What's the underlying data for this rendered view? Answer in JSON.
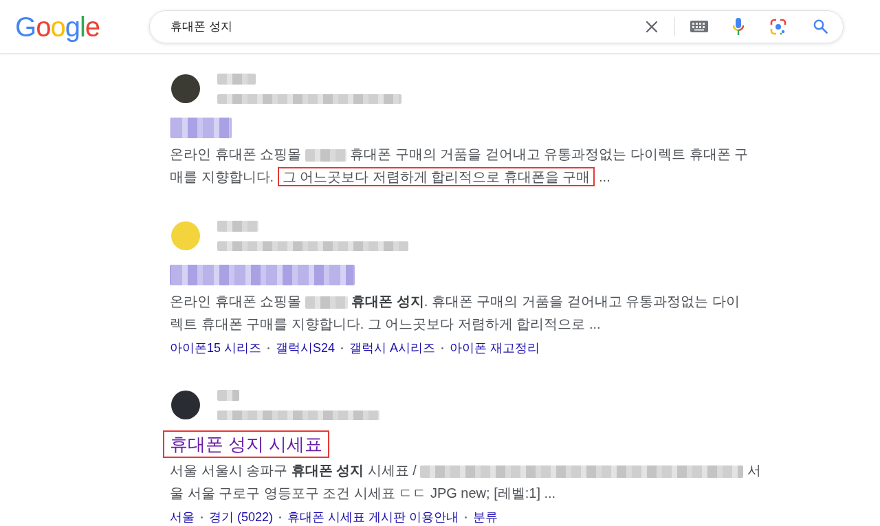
{
  "header": {
    "logo": "Google",
    "search": {
      "value": "휴대폰 성지"
    }
  },
  "results": [
    {
      "favicon": {
        "color": "#3b3a33"
      },
      "site": {
        "kind": "redacted"
      },
      "url": {
        "kind": "redacted"
      },
      "title": {
        "kind": "redacted"
      },
      "snippet": [
        [
          {
            "kind": "text",
            "text": "온라인 휴대폰 쇼핑몰",
            "marked": false
          },
          {
            "kind": "redacted"
          },
          {
            "kind": "text",
            "text": "휴대폰 구매의 거품을 걷어내고 유통과정없는 다이렉트 휴대폰 구",
            "marked": false
          }
        ],
        [
          {
            "kind": "text",
            "text": "매를 지향합니다.",
            "marked": false
          },
          {
            "kind": "text",
            "text": "그 어느곳보다 저렴하게 합리적으로 휴대폰을 구매",
            "marked": true
          },
          {
            "kind": "text",
            "text": "...",
            "marked": false
          }
        ]
      ]
    },
    {
      "favicon": {
        "color": "#f3d43c"
      },
      "site": {
        "kind": "redacted"
      },
      "url": {
        "kind": "redacted"
      },
      "title": {
        "kind": "redacted"
      },
      "snippet": [
        [
          {
            "kind": "text",
            "text": "온라인 휴대폰 쇼핑몰",
            "marked": false
          },
          {
            "kind": "redacted"
          },
          {
            "kind": "text",
            "text": "**휴대폰 성지**. 휴대폰 구매의 거품을 걷어내고 유통과정없는 다이",
            "marked": false
          }
        ],
        [
          {
            "kind": "text",
            "text": "렉트 휴대폰 구매를 지향합니다. 그 어느곳보다 저렴하게 합리적으로 ...",
            "marked": false
          }
        ]
      ],
      "sitelinks": [
        "아이폰15 시리즈",
        "갤럭시S24",
        "갤럭시 A시리즈",
        "아이폰 재고정리"
      ]
    },
    {
      "favicon": {
        "color": "#2a2c33"
      },
      "site": {
        "kind": "redacted"
      },
      "url": {
        "kind": "redacted"
      },
      "title": {
        "kind": "text",
        "text": "휴대폰 성지 시세표",
        "marked": true
      },
      "snippet": [
        [
          {
            "kind": "text",
            "text": "서울 서울시 송파구 **휴대폰 성지** 시세표 /",
            "marked": false
          },
          {
            "kind": "redacted"
          },
          {
            "kind": "text",
            "text": "서",
            "marked": false
          }
        ],
        [
          {
            "kind": "text",
            "text": "울 서울 구로구 영등포구 조건 시세표 ㄷㄷ JPG new; [레벨:1] ...",
            "marked": false
          }
        ]
      ],
      "sitelinks": [
        "서울",
        "경기 (5022)",
        "휴대폰 시세표 게시판 이용안내",
        "분류"
      ]
    }
  ]
}
